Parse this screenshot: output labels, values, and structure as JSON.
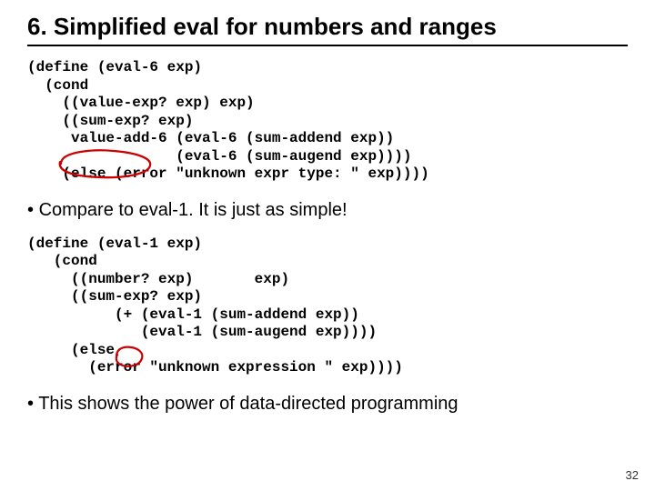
{
  "title": "6. Simplified eval for numbers and ranges",
  "code1": "(define (eval-6 exp)\n  (cond\n    ((value-exp? exp) exp)\n    ((sum-exp? exp)\n     value-add-6 (eval-6 (sum-addend exp))\n                 (eval-6 (sum-augend exp))))\n    (else (error \"unknown expr type: \" exp))))",
  "bullet1": "Compare to eval-1.  It is just as simple!",
  "code2": "(define (eval-1 exp)\n   (cond\n     ((number? exp)       exp)\n     ((sum-exp? exp)\n          (+ (eval-1 (sum-addend exp))\n             (eval-1 (sum-augend exp))))\n     (else\n       (error \"unknown expression \" exp))))",
  "bullet2": "This shows the power of data-directed programming",
  "page_number": "32"
}
